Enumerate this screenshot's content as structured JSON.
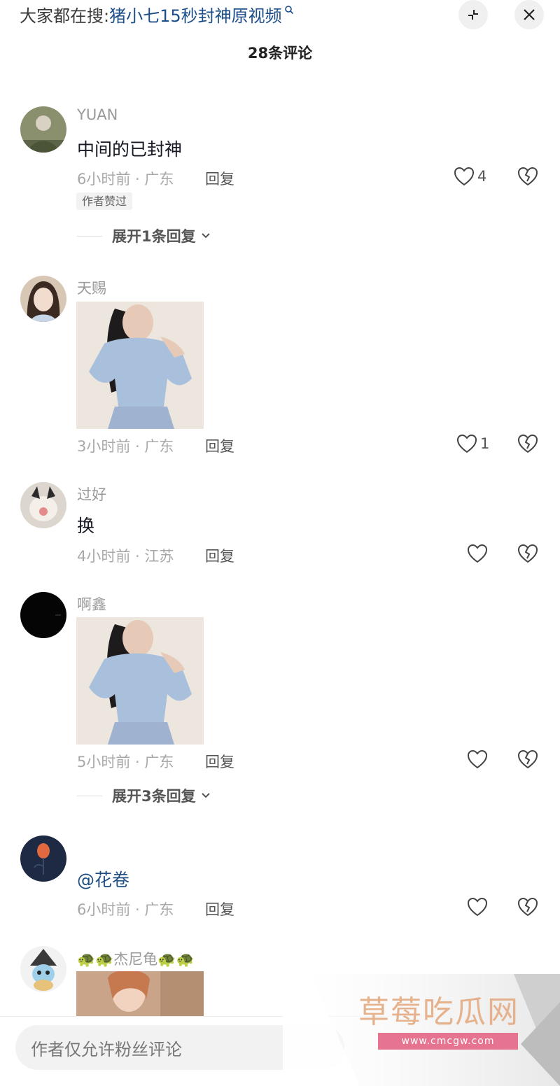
{
  "search_hint": {
    "prefix": "大家都在搜:",
    "query": "猪小七15秒封神原视频"
  },
  "header": {
    "title": "28条评论"
  },
  "common": {
    "reply_label": "回复"
  },
  "comments": [
    {
      "username": "YUAN",
      "text": "中间的已封神",
      "meta": "6小时前 · 广东",
      "likes": "4",
      "author_tag": "作者赞过",
      "expand": "展开1条回复"
    },
    {
      "username": "天赐",
      "image": "photo-woman-sweater",
      "meta": "3小时前 · 广东",
      "likes": "1"
    },
    {
      "username": "过好",
      "text": "换",
      "meta": "4小时前 · 江苏",
      "likes": ""
    },
    {
      "username": "啊鑫",
      "image": "photo-woman-sweater",
      "meta": "5小时前 · 广东",
      "likes": "",
      "expand": "展开3条回复"
    },
    {
      "username": "",
      "text": "@花卷",
      "meta": "6小时前 · 广东",
      "likes": ""
    },
    {
      "username": "🐢🐢杰尼龟🐢🐢",
      "image": "photo-woman-portrait"
    }
  ],
  "input": {
    "placeholder": "作者仅允许粉丝评论"
  },
  "watermark": {
    "title": "草莓吃瓜网",
    "url": "www.cmcgw.com"
  },
  "colors": {
    "query_link": "#1c4e8a",
    "mention": "#1f4e85",
    "meta_gray": "#a8a8a8",
    "watermark_text": "#e6b28d",
    "watermark_url_bg": "#e6738f"
  }
}
